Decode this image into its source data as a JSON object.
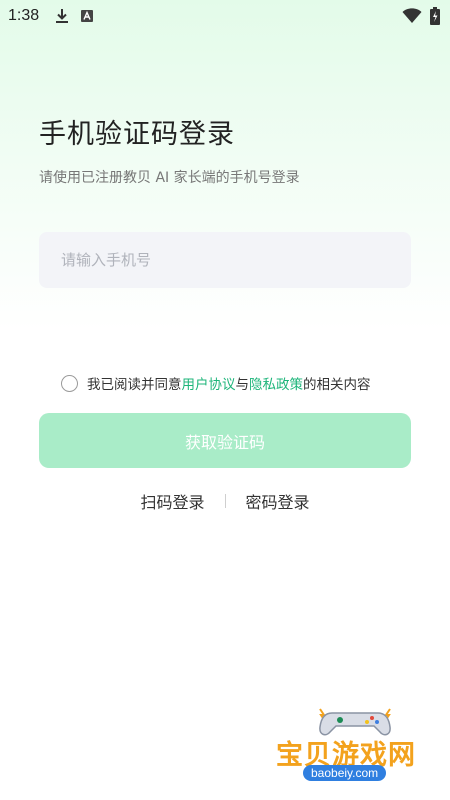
{
  "status_bar": {
    "time": "1:38",
    "icons": [
      "download-icon",
      "app-notification-icon",
      "wifi-icon",
      "battery-icon"
    ]
  },
  "page": {
    "title": "手机验证码登录",
    "subtitle": "请使用已注册教贝 AI 家长端的手机号登录"
  },
  "phone_input": {
    "placeholder": "请输入手机号",
    "value": ""
  },
  "agreement": {
    "checked": false,
    "prefix": "我已阅读并同意",
    "user_agreement": "用户协议",
    "and": "与",
    "privacy_policy": "隐私政策",
    "suffix": "的相关内容"
  },
  "get_code_button": {
    "label": "获取验证码"
  },
  "alt_logins": {
    "scan_label": "扫码登录",
    "password_label": "密码登录"
  },
  "watermark": {
    "title": "宝贝游戏网",
    "url": "baobeiy.com"
  },
  "colors": {
    "accent": "#1db57a",
    "button_disabled": "#a9ecc8",
    "input_bg": "#f3f4f8",
    "watermark_orange": "#f3a21d",
    "watermark_blue": "#2f7fe0"
  }
}
